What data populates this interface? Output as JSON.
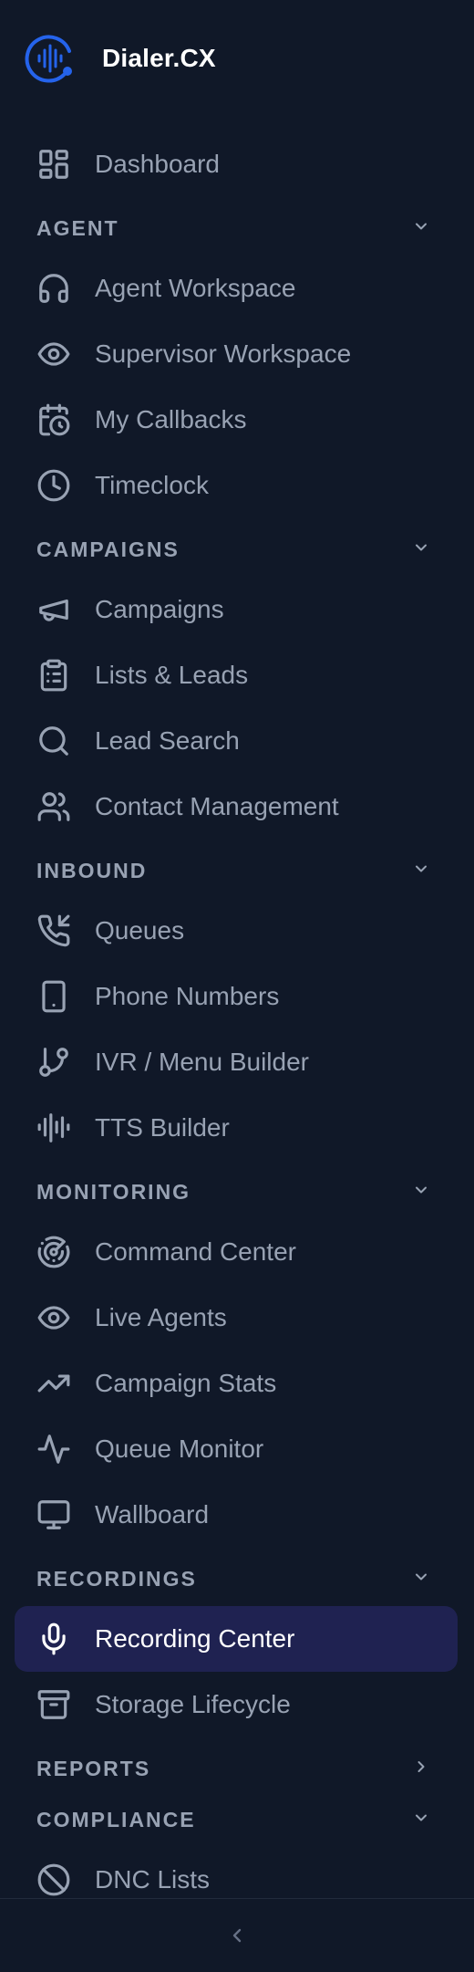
{
  "brand": {
    "name": "Dialer.CX",
    "accent_color": "#2563eb"
  },
  "nav": {
    "dashboard": {
      "label": "Dashboard",
      "icon": "dashboard-icon"
    },
    "sections": {
      "agent": {
        "title": "AGENT",
        "expanded": true,
        "items": [
          {
            "label": "Agent Workspace",
            "icon": "headset-icon"
          },
          {
            "label": "Supervisor Workspace",
            "icon": "eye-icon"
          },
          {
            "label": "My Callbacks",
            "icon": "calendar-clock-icon"
          },
          {
            "label": "Timeclock",
            "icon": "clock-icon"
          }
        ]
      },
      "campaigns": {
        "title": "CAMPAIGNS",
        "expanded": true,
        "items": [
          {
            "label": "Campaigns",
            "icon": "megaphone-icon"
          },
          {
            "label": "Lists & Leads",
            "icon": "clipboard-list-icon"
          },
          {
            "label": "Lead Search",
            "icon": "search-icon"
          },
          {
            "label": "Contact Management",
            "icon": "users-icon"
          }
        ]
      },
      "inbound": {
        "title": "INBOUND",
        "expanded": true,
        "items": [
          {
            "label": "Queues",
            "icon": "phone-incoming-icon"
          },
          {
            "label": "Phone Numbers",
            "icon": "smartphone-icon"
          },
          {
            "label": "IVR / Menu Builder",
            "icon": "git-branch-icon"
          },
          {
            "label": "TTS Builder",
            "icon": "audio-lines-icon"
          }
        ]
      },
      "monitoring": {
        "title": "MONITORING",
        "expanded": true,
        "items": [
          {
            "label": "Command Center",
            "icon": "radar-icon"
          },
          {
            "label": "Live Agents",
            "icon": "eye-icon"
          },
          {
            "label": "Campaign Stats",
            "icon": "trending-up-icon"
          },
          {
            "label": "Queue Monitor",
            "icon": "activity-icon"
          },
          {
            "label": "Wallboard",
            "icon": "monitor-icon"
          }
        ]
      },
      "recordings": {
        "title": "RECORDINGS",
        "expanded": true,
        "items": [
          {
            "label": "Recording Center",
            "icon": "microphone-icon",
            "active": true
          },
          {
            "label": "Storage Lifecycle",
            "icon": "archive-icon"
          }
        ]
      },
      "reports": {
        "title": "REPORTS",
        "expanded": false
      },
      "compliance": {
        "title": "COMPLIANCE",
        "expanded": true,
        "items": [
          {
            "label": "DNC Lists",
            "icon": "ban-icon"
          }
        ]
      }
    }
  },
  "footer": {
    "collapse_icon": "chevron-left-icon"
  },
  "colors": {
    "background": "#101828",
    "active_background": "#1f2251",
    "text": "#98a2b3",
    "active_text": "#ffffff"
  }
}
